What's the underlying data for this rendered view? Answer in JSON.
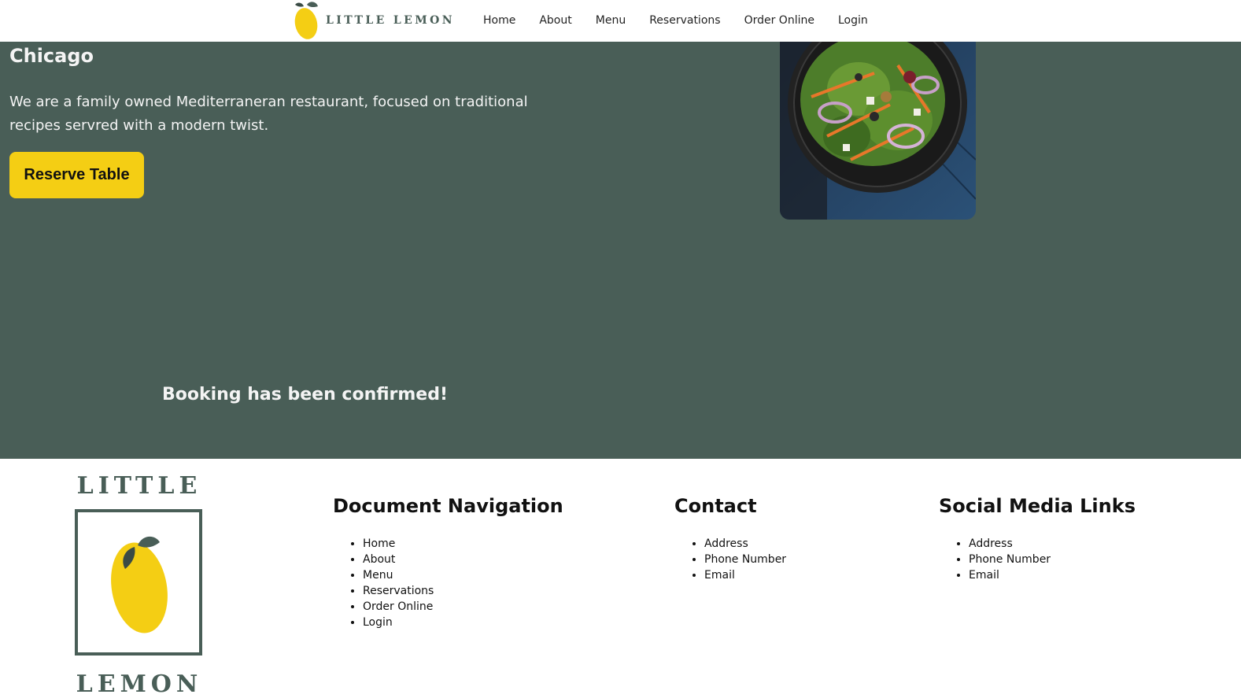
{
  "brand": {
    "name": "LITTLE LEMON",
    "colors": {
      "primary": "#495e57",
      "accent": "#f4ce14"
    }
  },
  "nav": {
    "items": [
      "Home",
      "About",
      "Menu",
      "Reservations",
      "Order Online",
      "Login"
    ]
  },
  "hero": {
    "city": "Chicago",
    "description": "We are a family owned Mediterraneran restaurant, focused on traditional recipes servred with a modern twist.",
    "reserve_button": "Reserve Table",
    "image_icon": "salad-bowl-image"
  },
  "confirmation": {
    "message": "Booking has been confirmed!"
  },
  "footer": {
    "logo_top": "LITTLE",
    "logo_bottom": "LEMON",
    "navigation": {
      "title": "Document Navigation",
      "items": [
        "Home",
        "About",
        "Menu",
        "Reservations",
        "Order Online",
        "Login"
      ]
    },
    "contact": {
      "title": "Contact",
      "items": [
        "Address",
        "Phone Number",
        "Email"
      ]
    },
    "social": {
      "title": "Social Media Links",
      "items": [
        "Address",
        "Phone Number",
        "Email"
      ]
    }
  }
}
